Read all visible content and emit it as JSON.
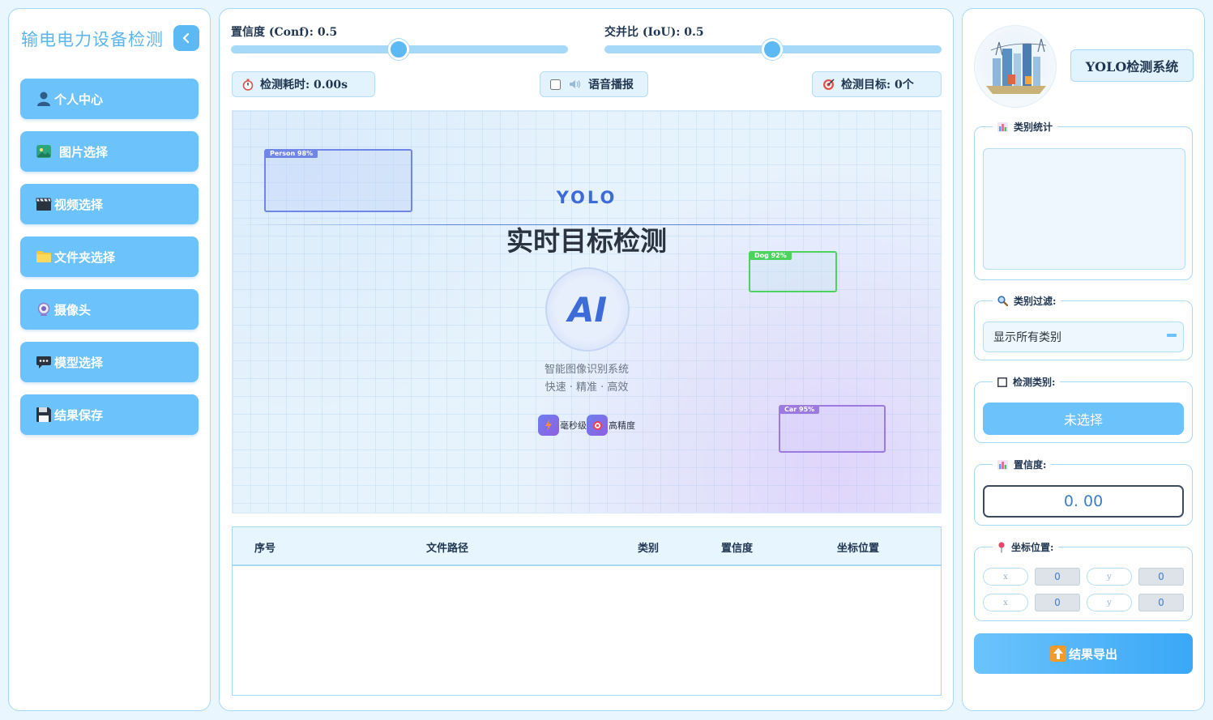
{
  "sidebar": {
    "title": "输电电力设备检测",
    "items": [
      {
        "label": "个人中心",
        "icon": "user-icon"
      },
      {
        "label": "图片选择",
        "icon": "image-icon"
      },
      {
        "label": "视频选择",
        "icon": "clapperboard-icon"
      },
      {
        "label": "文件夹选择",
        "icon": "folder-icon"
      },
      {
        "label": "摄像头",
        "icon": "camera-icon"
      },
      {
        "label": "模型选择",
        "icon": "chat-bubble-icon"
      },
      {
        "label": "结果保存",
        "icon": "floppy-icon"
      }
    ]
  },
  "controls": {
    "conf_label": "置信度 (Conf): 0.5",
    "conf_value": 0.5,
    "iou_label": "交并比 (IoU): 0.5",
    "iou_value": 0.5,
    "time_label": "检测耗时: 0.00s",
    "voice_label": "语音播报",
    "voice_checked": false,
    "targets_label": "检测目标: 0个"
  },
  "preview": {
    "brand": "YOLO",
    "title": "实时目标检测",
    "ai_badge": "AI",
    "subtitle": "智能图像识别系统",
    "tagline": "快速 · 精准 · 高效",
    "features": [
      {
        "label": "毫秒级",
        "icon": "lightning-icon"
      },
      {
        "label": "高精度",
        "icon": "target-icon"
      }
    ],
    "boxes": [
      {
        "tag": "Person 98%",
        "color": "#6f86e6"
      },
      {
        "tag": "Dog 92%",
        "color": "#4cd35e"
      },
      {
        "tag": "Car 95%",
        "color": "#9c7ae0"
      }
    ]
  },
  "table": {
    "headers": [
      "序号",
      "文件路径",
      "类别",
      "置信度",
      "坐标位置"
    ],
    "rows": []
  },
  "right": {
    "system_title": "YOLO检测系统",
    "stats_legend": "类别统计",
    "filter_legend": "类别过滤:",
    "filter_value": "显示所有类别",
    "class_legend": "检测类别:",
    "class_button": "未选择",
    "conf_legend": "置信度:",
    "conf_value": "0. 00",
    "coord_legend": "坐标位置:",
    "coords": {
      "x1_label": "x",
      "x1": "0",
      "y1_label": "y",
      "y1": "0",
      "x2_label": "x",
      "x2": "0",
      "y2_label": "y",
      "y2": "0"
    },
    "export_label": "结果导出"
  },
  "colors": {
    "accent": "#6cc3fb",
    "accent_dark": "#5cb9f4",
    "panel_border": "#a7d8f6",
    "background": "#eaf6fe"
  }
}
